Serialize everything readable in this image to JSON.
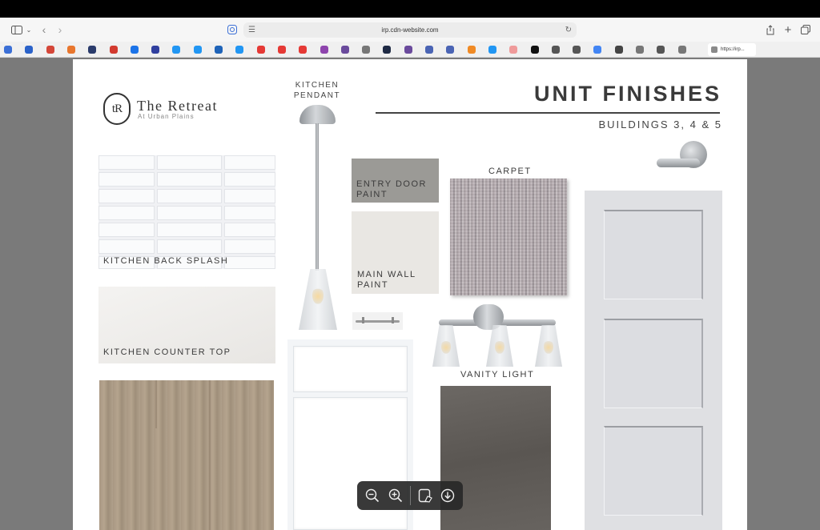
{
  "browser": {
    "url": "irp.cdn-website.com",
    "tab_label": "https://irp...",
    "favorites_colors": [
      "#3b6fd6",
      "#2a62c9",
      "#d44638",
      "#e8762d",
      "#2a3b6b",
      "#d23a2f",
      "#1b73e8",
      "#303f9f",
      "#2196f3",
      "#2196f3",
      "#1e63b8",
      "#2196f3",
      "#e53935",
      "#e53935",
      "#e53935",
      "#8e44ad",
      "#6a4a9c",
      "#777777",
      "#1f2a44",
      "#6a4a9c",
      "#4a64b4",
      "#4a64b4",
      "#f08a24",
      "#2196f3",
      "#ef9a9a",
      "#111111",
      "#555555",
      "#555555",
      "#4285f4",
      "#444444",
      "#777777",
      "#555555",
      "#777777"
    ]
  },
  "brand": {
    "monogram": "tR",
    "name": "The Retreat",
    "subtitle": "At Urban Plains"
  },
  "header": {
    "title": "UNIT FINISHES",
    "subtitle": "BUILDINGS 3, 4 & 5"
  },
  "labels": {
    "kitchen_pendant_line1": "KITCHEN",
    "kitchen_pendant_line2": "PENDANT",
    "entry_door_paint_line1": "ENTRY DOOR",
    "entry_door_paint_line2": "PAINT",
    "main_wall_paint_line1": "MAIN WALL",
    "main_wall_paint_line2": "PAINT",
    "carpet": "CARPET",
    "kitchen_back_splash": "KITCHEN BACK SPLASH",
    "kitchen_counter_top": "KITCHEN COUNTER TOP",
    "vanity_light": "VANITY LIGHT"
  },
  "colors": {
    "entry_door_paint": "#9b9a96",
    "main_wall_paint": "#e9e7e3",
    "door": "#dfe0e3"
  },
  "pdf_toolbar": {
    "buttons": [
      "zoom-out-icon",
      "zoom-in-icon",
      "annotate-icon",
      "download-icon"
    ]
  }
}
